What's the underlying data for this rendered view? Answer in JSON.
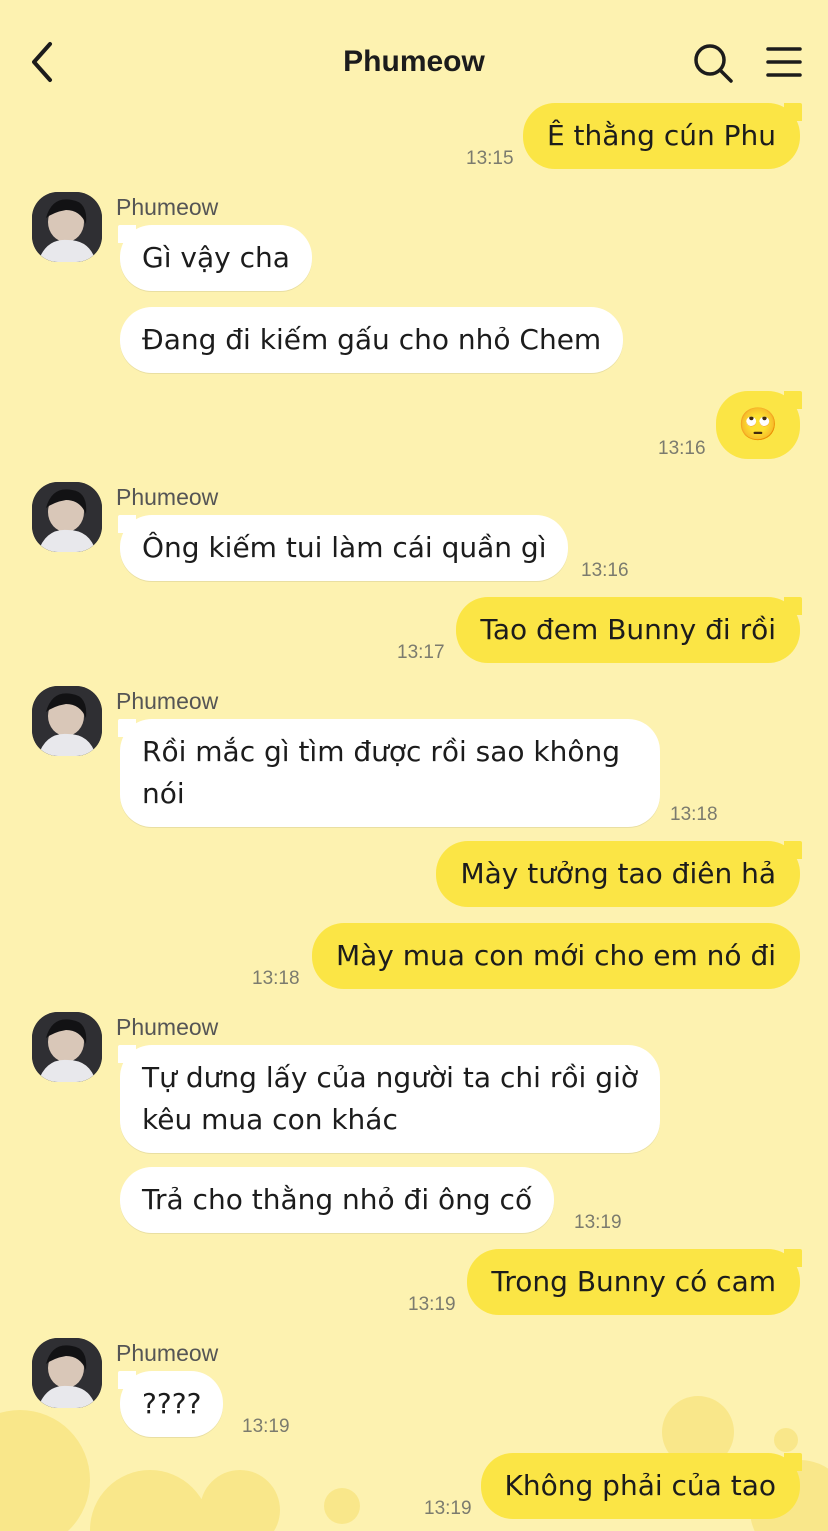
{
  "header": {
    "title": "Phumeow"
  },
  "messages": [
    {
      "text": "Ê thằng cún Phu",
      "time": "13:15"
    },
    {
      "sender": "Phumeow",
      "text": "Gì vậy cha"
    },
    {
      "text": "Đang đi kiếm gấu cho nhỏ Chem"
    },
    {
      "text": "🙄",
      "time": "13:16"
    },
    {
      "sender": "Phumeow",
      "text": "Ông kiếm tui làm cái quần gì",
      "time": "13:16"
    },
    {
      "text": "Tao đem Bunny đi rồi",
      "time": "13:17"
    },
    {
      "sender": "Phumeow",
      "text": "Rồi mắc gì tìm được rồi sao không nói",
      "time": "13:18"
    },
    {
      "text": "Mày tưởng tao điên hả"
    },
    {
      "text": "Mày mua con mới cho em nó đi",
      "time": "13:18"
    },
    {
      "sender": "Phumeow",
      "text": "Tự dưng lấy của người ta chi rồi giờ kêu mua con khác"
    },
    {
      "text": "Trả cho thằng nhỏ đi ông cố",
      "time": "13:19"
    },
    {
      "text": "Trong Bunny có cam",
      "time": "13:19"
    },
    {
      "sender": "Phumeow",
      "text": "????",
      "time": "13:19"
    },
    {
      "text": "Không phải của tao",
      "time": "13:19"
    }
  ],
  "icons": {
    "back": "chevron-left-icon",
    "search": "search-icon",
    "menu": "hamburger-menu-icon"
  },
  "colors": {
    "background": "#fdf2b0",
    "outgoing_bubble": "#fbe545",
    "incoming_bubble": "#ffffff"
  }
}
